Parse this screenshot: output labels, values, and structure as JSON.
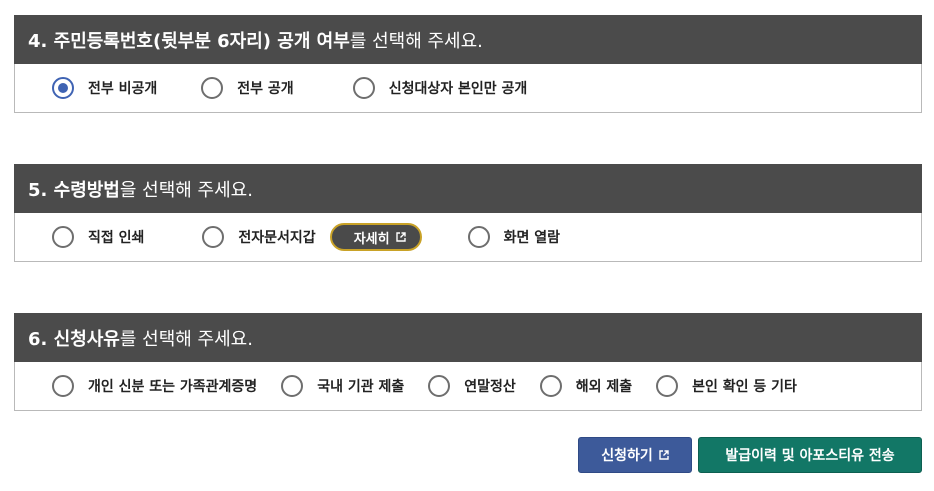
{
  "section4": {
    "title_bold": "4. 주민등록번호(뒷부분 6자리) 공개 여부",
    "title_rest": "를 선택해 주세요.",
    "options": [
      {
        "label": "전부 비공개",
        "selected": true
      },
      {
        "label": "전부 공개",
        "selected": false
      },
      {
        "label": "신청대상자 본인만 공개",
        "selected": false
      }
    ]
  },
  "section5": {
    "title_bold": "5. 수령방법",
    "title_rest": "을 선택해 주세요.",
    "options": [
      {
        "label": "직접 인쇄",
        "selected": false
      },
      {
        "label": "전자문서지갑",
        "selected": false
      },
      {
        "label": "화면 열람",
        "selected": false
      }
    ],
    "detail_button": "자세히"
  },
  "section6": {
    "title_bold": "6. 신청사유",
    "title_rest": "를 선택해 주세요.",
    "options": [
      {
        "label": "개인 신분 또는 가족관계증명",
        "selected": false
      },
      {
        "label": "국내 기관 제출",
        "selected": false
      },
      {
        "label": "연말정산",
        "selected": false
      },
      {
        "label": "해외 제출",
        "selected": false
      },
      {
        "label": "본인 확인 등 기타",
        "selected": false
      }
    ]
  },
  "actions": {
    "apply_label": "신청하기",
    "history_label": "발급이력 및 아포스티유 전송"
  },
  "colors": {
    "header_bg": "#4b4b4b",
    "radio_selected": "#3f63b3",
    "apply_bg": "#3d5a9a",
    "history_bg": "#127766",
    "pill_border": "#c9a227"
  },
  "icons": {
    "external_link": "external-link-icon",
    "radio": "radio-icon"
  }
}
